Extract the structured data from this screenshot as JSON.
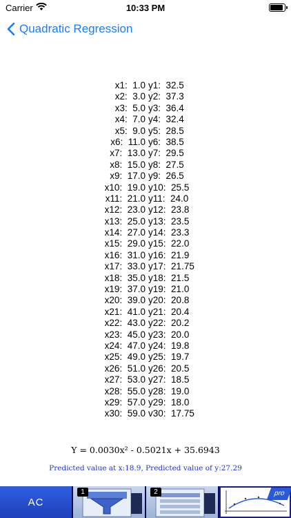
{
  "status_bar": {
    "carrier": "Carrier",
    "time": "10:33 PM"
  },
  "nav": {
    "back_label": "Quadratic Regression"
  },
  "data_points": [
    {
      "x_label": "x1:",
      "x": "1.0",
      "y_label": "y1:",
      "y": "32.5"
    },
    {
      "x_label": "x2:",
      "x": "3.0",
      "y_label": "y2:",
      "y": "37.3"
    },
    {
      "x_label": "x3:",
      "x": "5.0",
      "y_label": "y3:",
      "y": "36.4"
    },
    {
      "x_label": "x4:",
      "x": "7.0",
      "y_label": "y4:",
      "y": "32.4"
    },
    {
      "x_label": "x5:",
      "x": "9.0",
      "y_label": "y5:",
      "y": "28.5"
    },
    {
      "x_label": "x6:",
      "x": "11.0",
      "y_label": "y6:",
      "y": "38.5"
    },
    {
      "x_label": "x7:",
      "x": "13.0",
      "y_label": "y7:",
      "y": "29.5"
    },
    {
      "x_label": "x8:",
      "x": "15.0",
      "y_label": "y8:",
      "y": "27.5"
    },
    {
      "x_label": "x9:",
      "x": "17.0",
      "y_label": "y9:",
      "y": "26.5"
    },
    {
      "x_label": "x10:",
      "x": "19.0",
      "y_label": "y10:",
      "y": "25.5"
    },
    {
      "x_label": "x11:",
      "x": "21.0",
      "y_label": "y11:",
      "y": "24.0"
    },
    {
      "x_label": "x12:",
      "x": "23.0",
      "y_label": "y12:",
      "y": "23.8"
    },
    {
      "x_label": "x13:",
      "x": "25.0",
      "y_label": "y13:",
      "y": "23.5"
    },
    {
      "x_label": "x14:",
      "x": "27.0",
      "y_label": "y14:",
      "y": "23.3"
    },
    {
      "x_label": "x15:",
      "x": "29.0",
      "y_label": "y15:",
      "y": "22.0"
    },
    {
      "x_label": "x16:",
      "x": "31.0",
      "y_label": "y16:",
      "y": "21.9"
    },
    {
      "x_label": "x17:",
      "x": "33.0",
      "y_label": "y17:",
      "y": "21.75"
    },
    {
      "x_label": "x18:",
      "x": "35.0",
      "y_label": "y18:",
      "y": "21.5"
    },
    {
      "x_label": "x19:",
      "x": "37.0",
      "y_label": "y19:",
      "y": "21.0"
    },
    {
      "x_label": "x20:",
      "x": "39.0",
      "y_label": "y20:",
      "y": "20.8"
    },
    {
      "x_label": "x21:",
      "x": "41.0",
      "y_label": "y21:",
      "y": "20.4"
    },
    {
      "x_label": "x22:",
      "x": "43.0",
      "y_label": "y22:",
      "y": "20.2"
    },
    {
      "x_label": "x23:",
      "x": "45.0",
      "y_label": "y23:",
      "y": "20.0"
    },
    {
      "x_label": "x24:",
      "x": "47.0",
      "y_label": "y24:",
      "y": "19.8"
    },
    {
      "x_label": "x25:",
      "x": "49.0",
      "y_label": "y25:",
      "y": "19.7"
    },
    {
      "x_label": "x26:",
      "x": "51.0",
      "y_label": "y26:",
      "y": "20.5"
    },
    {
      "x_label": "x27:",
      "x": "53.0",
      "y_label": "y27:",
      "y": "18.5"
    },
    {
      "x_label": "x28:",
      "x": "55.0",
      "y_label": "y28:",
      "y": "19.0"
    },
    {
      "x_label": "x29:",
      "x": "57.0",
      "y_label": "y29:",
      "y": "18.0"
    },
    {
      "x_label": "x30:",
      "x": "59.0",
      "y_label": "v30:",
      "y": "17.75"
    }
  ],
  "equation": "Y = 0.0030x² - 0.5021x + 35.6943",
  "predicted": "Predicted value at x:18.9, Predicted value of y:27.29",
  "toolbar": {
    "ac_label": "AC",
    "tile1_badge": "1",
    "tile2_badge": "2",
    "pro_label": "pro"
  },
  "colors": {
    "accent": "#1a7cf5",
    "predicted_text": "#2233cc",
    "toolbar_bg": "#1c1c8e",
    "ac_button": "#2f5fe0"
  }
}
